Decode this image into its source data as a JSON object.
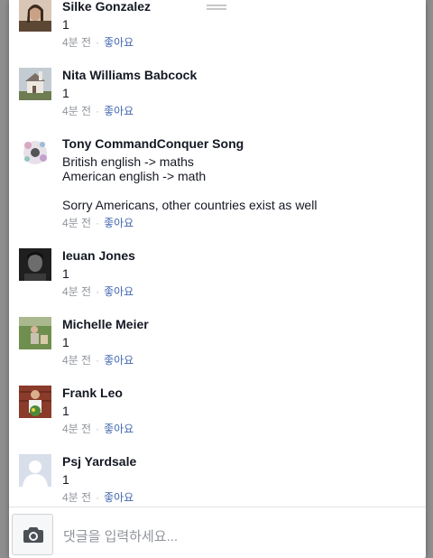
{
  "comments": [
    {
      "author": "Silke Gonzalez",
      "text": "1",
      "time": "4분 전",
      "like_label": "좋아요"
    },
    {
      "author": "Nita Williams Babcock",
      "text": "1",
      "time": "4분 전",
      "like_label": "좋아요"
    },
    {
      "author": "Tony CommandConquer Song",
      "text": "British english -> maths\nAmerican english -> math\n\nSorry Americans, other countries exist as well",
      "time": "4분 전",
      "like_label": "좋아요"
    },
    {
      "author": "Ieuan Jones",
      "text": "1",
      "time": "4분 전",
      "like_label": "좋아요"
    },
    {
      "author": "Michelle Meier",
      "text": "1",
      "time": "4분 전",
      "like_label": "좋아요"
    },
    {
      "author": "Frank Leo",
      "text": "1",
      "time": "4분 전",
      "like_label": "좋아요"
    },
    {
      "author": "Psj Yardsale",
      "text": "1",
      "time": "4분 전",
      "like_label": "좋아요"
    }
  ],
  "composer": {
    "placeholder": "댓글을 입력하세요...",
    "camera_icon": "camera-icon"
  },
  "colors": {
    "author": "#141823",
    "meta": "#90949c",
    "like_link": "#4267b2",
    "backdrop": "#9a9a9a"
  }
}
